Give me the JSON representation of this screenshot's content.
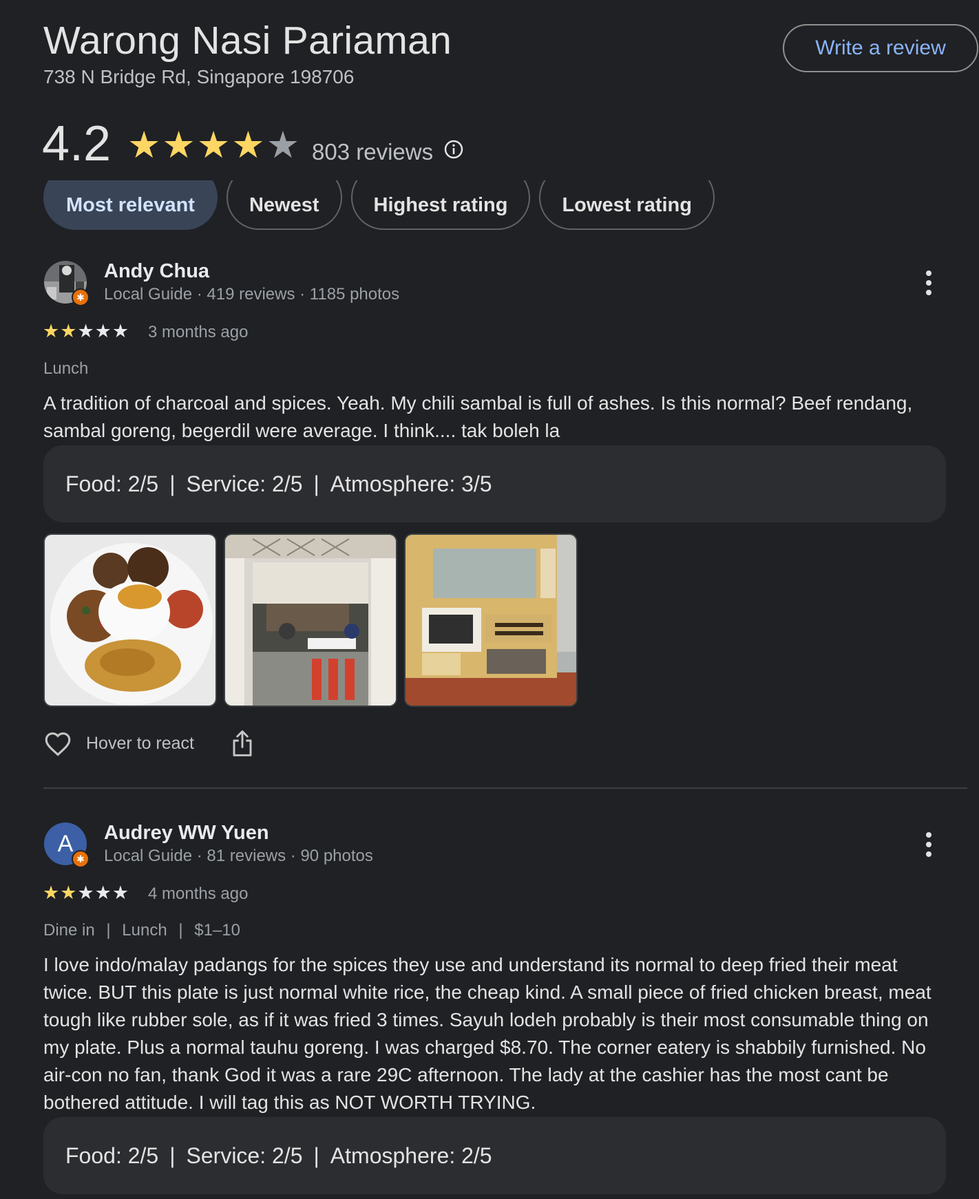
{
  "place": {
    "name": "Warong Nasi Pariaman",
    "address": "738 N Bridge Rd, Singapore 198706",
    "write_review_label": "Write a review",
    "rating": "4.2",
    "rating_stars_filled": 4,
    "rating_stars_total": 5,
    "review_count": "803 reviews",
    "info_icon": "info-icon"
  },
  "sort_chips": [
    {
      "label": "Most relevant",
      "active": true
    },
    {
      "label": "Newest",
      "active": false
    },
    {
      "label": "Highest rating",
      "active": false
    },
    {
      "label": "Lowest rating",
      "active": false
    }
  ],
  "reviews": [
    {
      "author": "Andy Chua",
      "meta": "Local Guide · 419 reviews · 1185 photos",
      "stars": 2,
      "time": "3 months ago",
      "tags": "Lunch",
      "text": "A tradition of charcoal and spices. Yeah. My chili sambal is full of ashes. Is this normal? Beef rendang, sambal goreng, begerdil were average. I think.... tak boleh la",
      "food": "Food: 2/5",
      "service": "Service: 2/5",
      "atmosphere": "Atmosphere: 3/5",
      "react_label": "Hover to react",
      "avatar_icon": "profile-photo"
    },
    {
      "author": "Audrey WW Yuen",
      "meta": "Local Guide · 81 reviews · 90 photos",
      "stars": 2,
      "time": "4 months ago",
      "tags_list": [
        "Dine in",
        "Lunch",
        "$1–10"
      ],
      "text": "I love indo/malay padangs for the spices they use and understand its normal to deep fried their meat twice. BUT this plate is just normal white rice, the cheap kind. A small piece of fried chicken breast, meat tough like rubber sole, as if it was fried 3 times. Sayuh lodeh probably is their most consumable thing on my plate. Plus a normal tauhu goreng. I was charged $8.70. The corner eatery is shabbily furnished. No air-con no fan, thank God it was a rare 29C afternoon. The lady at the cashier has the most cant be bothered attitude. I will tag this as NOT WORTH TRYING.",
      "food": "Food: 2/5",
      "service": "Service: 2/5",
      "atmosphere": "Atmosphere: 2/5",
      "avatar_letter": "A"
    }
  ],
  "separator": "|",
  "colors": {
    "background": "#202124",
    "star_gold": "#fdd663",
    "accent_blue": "#8ab4f8",
    "active_chip": "#394457",
    "avatar_blue": "#3c5fa6",
    "local_guide_badge": "#e8710a"
  }
}
